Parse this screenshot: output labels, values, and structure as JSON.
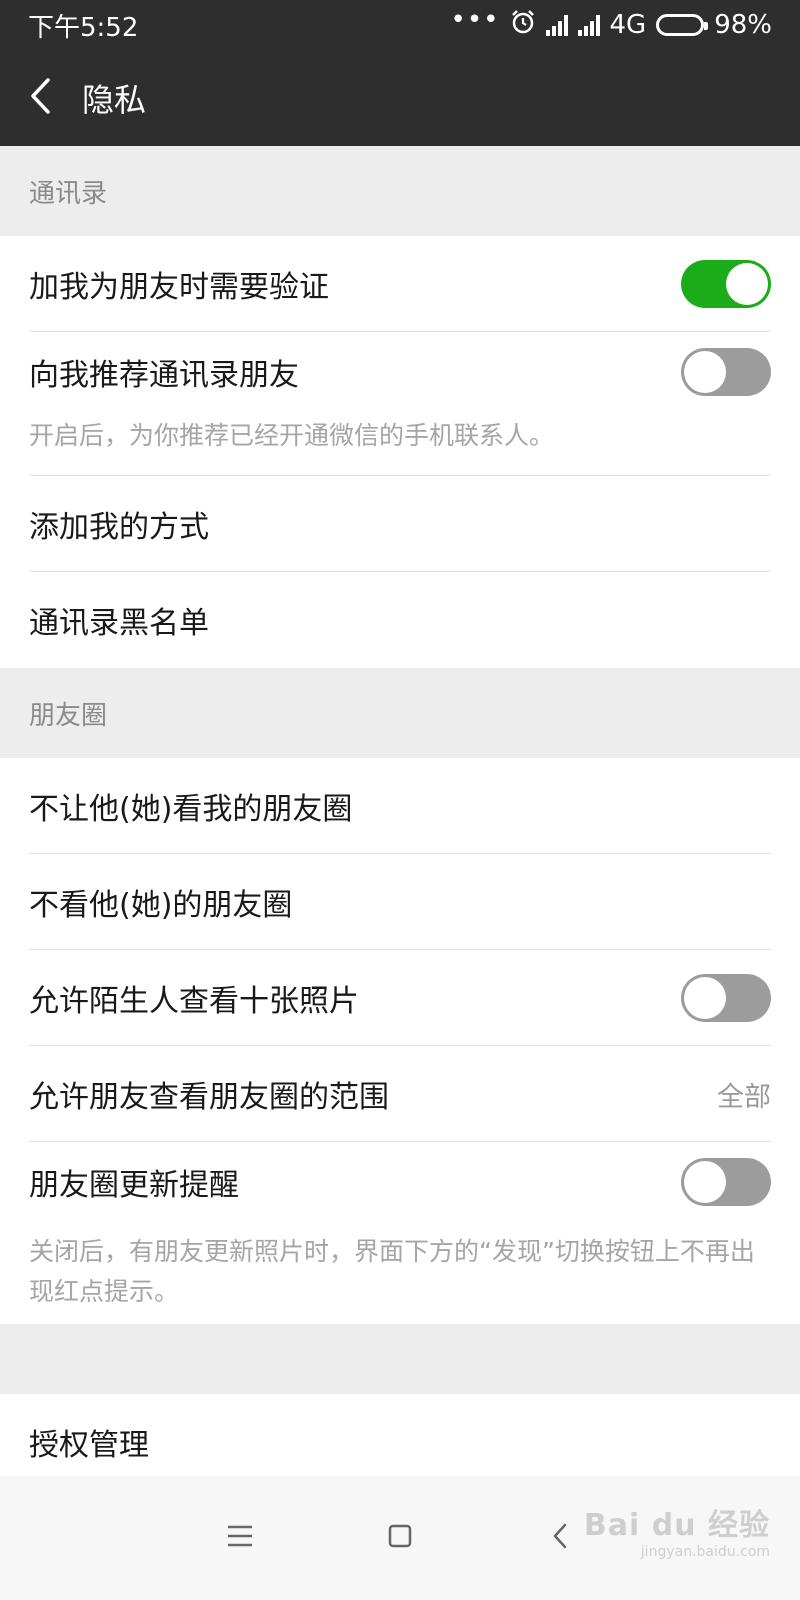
{
  "status_bar": {
    "time": "下午5:52",
    "network": "4G",
    "battery": "98%",
    "battery_level": 0.98
  },
  "header": {
    "title": "隐私",
    "back_icon": "chevron-left-icon"
  },
  "sections": {
    "contacts": {
      "header": "通讯录",
      "items": [
        {
          "label": "加我为朋友时需要验证",
          "toggle": true
        },
        {
          "label": "向我推荐通讯录朋友",
          "toggle": false
        },
        {
          "label": "添加我的方式"
        },
        {
          "label": "通讯录黑名单"
        }
      ],
      "hint": "开启后，为你推荐已经开通微信的手机联系人。"
    },
    "moments": {
      "header": "朋友圈",
      "items": [
        {
          "label": "不让他(她)看我的朋友圈"
        },
        {
          "label": "不看他(她)的朋友圈"
        },
        {
          "label": "允许陌生人查看十张照片",
          "toggle": false
        },
        {
          "label": "允许朋友查看朋友圈的范围",
          "value": "全部"
        },
        {
          "label": "朋友圈更新提醒",
          "toggle": false
        }
      ],
      "hint": "关闭后，有朋友更新照片时，界面下方的“发现”切换按钮上不再出现红点提示。"
    },
    "auth": {
      "items": [
        {
          "label": "授权管理"
        }
      ]
    }
  },
  "watermark": {
    "main": "Bai du 经验",
    "sub": "jingyan.baidu.com"
  },
  "colors": {
    "toggle_on": "#1aad19",
    "toggle_off": "#9c9c9c",
    "bar_bg": "#2e2e2e",
    "page_bg": "#ededed"
  }
}
